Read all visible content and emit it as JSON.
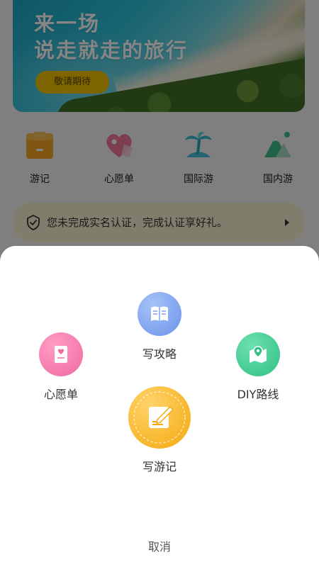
{
  "banner": {
    "title_line1": "来一场",
    "title_line2": "说走就走的旅行",
    "button_label": "敬请期待"
  },
  "quick_nav": [
    {
      "label": "游记",
      "icon": "travel-notes-icon"
    },
    {
      "label": "心愿单",
      "icon": "heart-wishlist-icon"
    },
    {
      "label": "国际游",
      "icon": "palm-island-icon"
    },
    {
      "label": "国内游",
      "icon": "mountain-icon"
    }
  ],
  "notice": {
    "text": "您未完成实名认证，完成认证享好礼。",
    "icon": "shield-check-icon"
  },
  "sheet": {
    "actions": [
      {
        "label": "写攻略",
        "icon": "book-icon",
        "color": "#7ea3ee"
      },
      {
        "label": "心愿单",
        "icon": "wishlist-card-icon",
        "color": "#f27aa8"
      },
      {
        "label": "DIY路线",
        "icon": "map-pin-icon",
        "color": "#3fcf93"
      },
      {
        "label": "写游记",
        "icon": "pencil-note-icon",
        "color": "#f7b21e"
      }
    ],
    "cancel_label": "取消"
  }
}
